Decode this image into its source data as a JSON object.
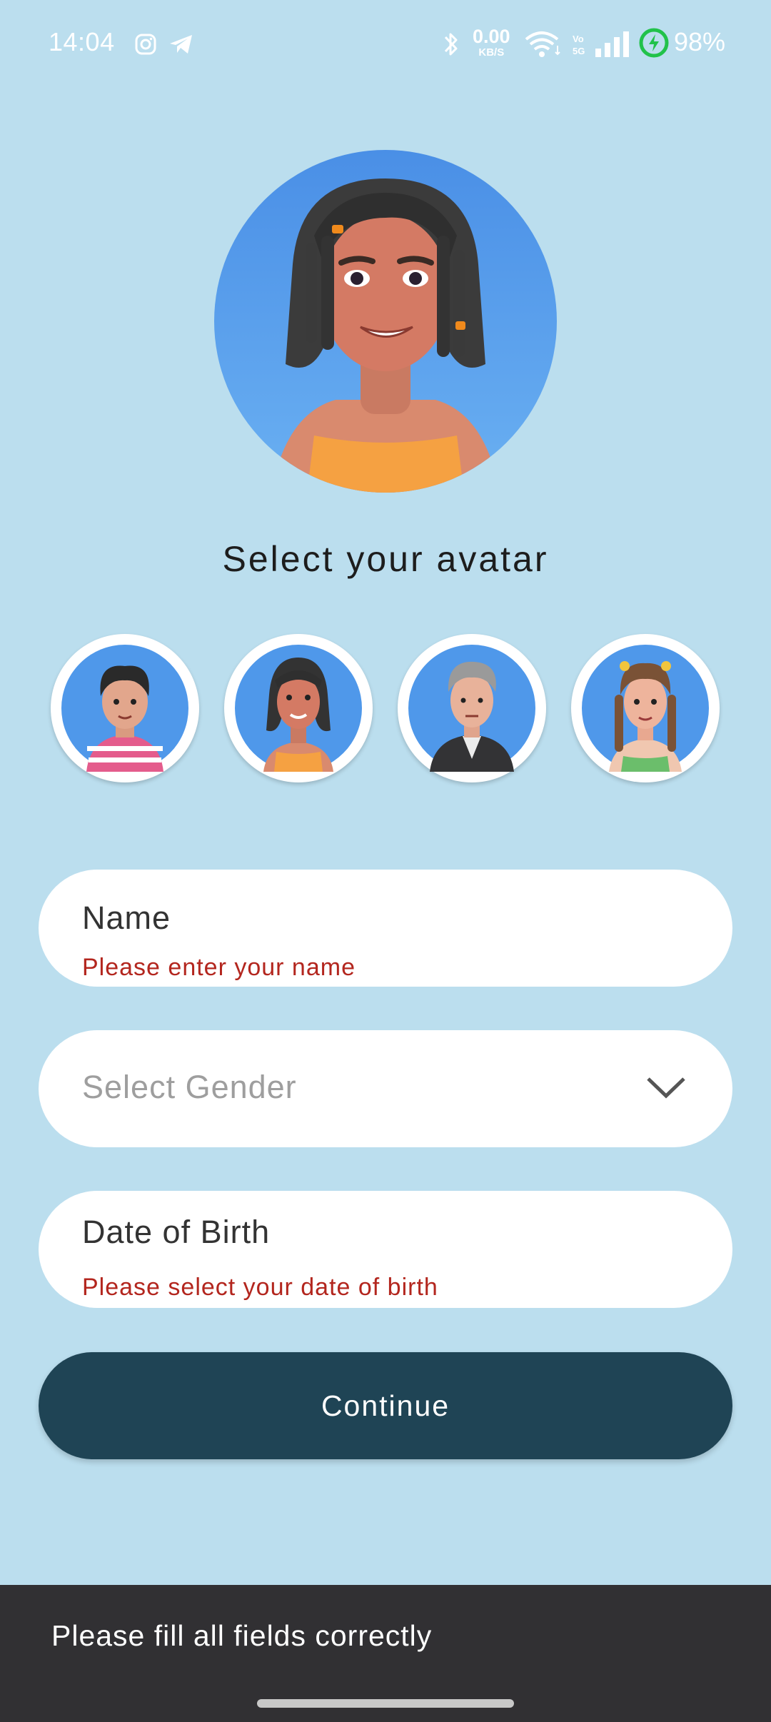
{
  "status_bar": {
    "time": "14:04",
    "net_speed_value": "0.00",
    "net_speed_unit": "KB/S",
    "battery": "98%",
    "icons": [
      "instagram-icon",
      "telegram-icon",
      "bluetooth-icon",
      "wifi-icon",
      "volte-icon",
      "signal-icon",
      "battery-charging-icon"
    ]
  },
  "avatar_section": {
    "heading": "Select your avatar",
    "selected_avatar": "avatar-2",
    "options": [
      "avatar-1",
      "avatar-2",
      "avatar-3",
      "avatar-4"
    ]
  },
  "form": {
    "name": {
      "label": "Name",
      "error": "Please enter your name"
    },
    "gender": {
      "placeholder": "Select Gender"
    },
    "dob": {
      "label": "Date of Birth",
      "error": "Please select your date of birth"
    },
    "continue_label": "Continue"
  },
  "snackbar": {
    "message": "Please fill all fields correctly"
  },
  "colors": {
    "background": "#BBDEEE",
    "primary_button": "#1F4455",
    "error": "#B3261E",
    "snackbar": "#313033",
    "avatar_bg": "#5A9FEA"
  }
}
